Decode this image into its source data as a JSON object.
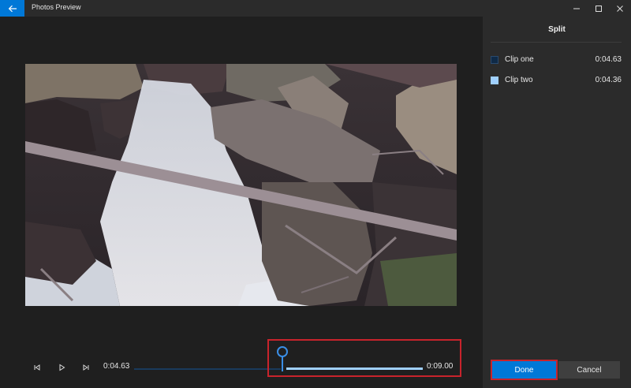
{
  "window": {
    "title": "Photos Preview"
  },
  "player": {
    "current_time": "0:04.63",
    "end_time": "0:09.00",
    "split_position_fraction": 0.514
  },
  "panel": {
    "title": "Split",
    "clips": [
      {
        "name": "Clip one",
        "duration": "0:04.63",
        "color": "#0f2a47"
      },
      {
        "name": "Clip two",
        "duration": "0:04.36",
        "color": "#9fd0ff"
      }
    ]
  },
  "actions": {
    "done_label": "Done",
    "cancel_label": "Cancel"
  },
  "colors": {
    "accent": "#0078d7",
    "highlight": "#c8232c"
  }
}
